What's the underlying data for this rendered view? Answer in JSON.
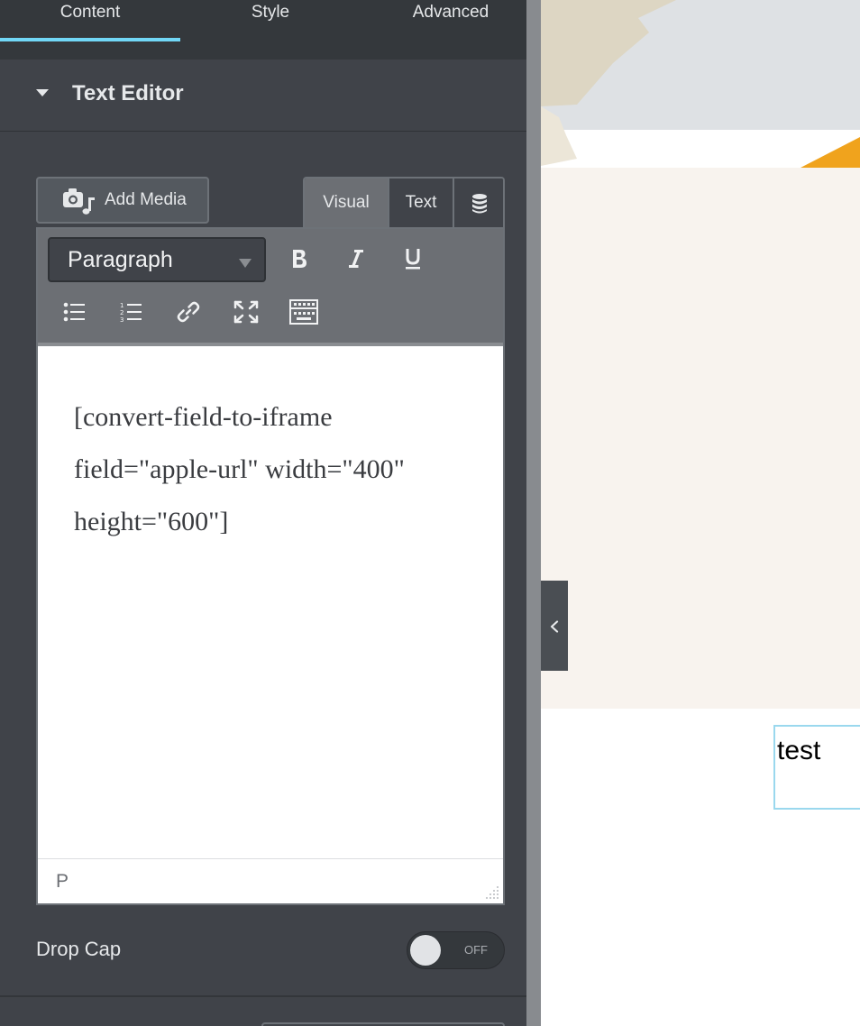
{
  "panel": {
    "tabs": [
      {
        "label": "Content",
        "active": true
      },
      {
        "label": "Style",
        "active": false
      },
      {
        "label": "Advanced",
        "active": false
      }
    ],
    "section": {
      "title": "Text Editor",
      "expanded": true
    },
    "add_media": {
      "label": "Add Media",
      "icon": "camera-music-icon"
    },
    "editor_modes": [
      {
        "label": "Visual",
        "active": true
      },
      {
        "label": "Text",
        "active": false
      },
      {
        "label": "",
        "icon": "database-icon"
      }
    ],
    "toolbar": {
      "format": "Paragraph",
      "buttons": [
        "bold-icon",
        "italic-icon",
        "underline-icon",
        "bulleted-list-icon",
        "numbered-list-icon",
        "link-icon",
        "fullscreen-icon",
        "keyboard-icon"
      ]
    },
    "editor": {
      "lines": [
        "[convert-field-to-iframe",
        "field=\"apple-url\" width=\"400\"",
        "height=\"600\"]"
      ],
      "path": "P"
    },
    "drop_cap": {
      "label": "Drop Cap",
      "state": "OFF",
      "enabled": false
    }
  },
  "preview": {
    "test_text": "test",
    "colors": {
      "hero": "#dee1e4",
      "cream": "#f8f3ee",
      "accent_orange": "#f0a31d",
      "selection": "#9ad8ee"
    }
  },
  "colors": {
    "panel_bg": "#404349",
    "tab_indicator": "#71d7f7",
    "toolbar_bg": "#6c6f74"
  }
}
